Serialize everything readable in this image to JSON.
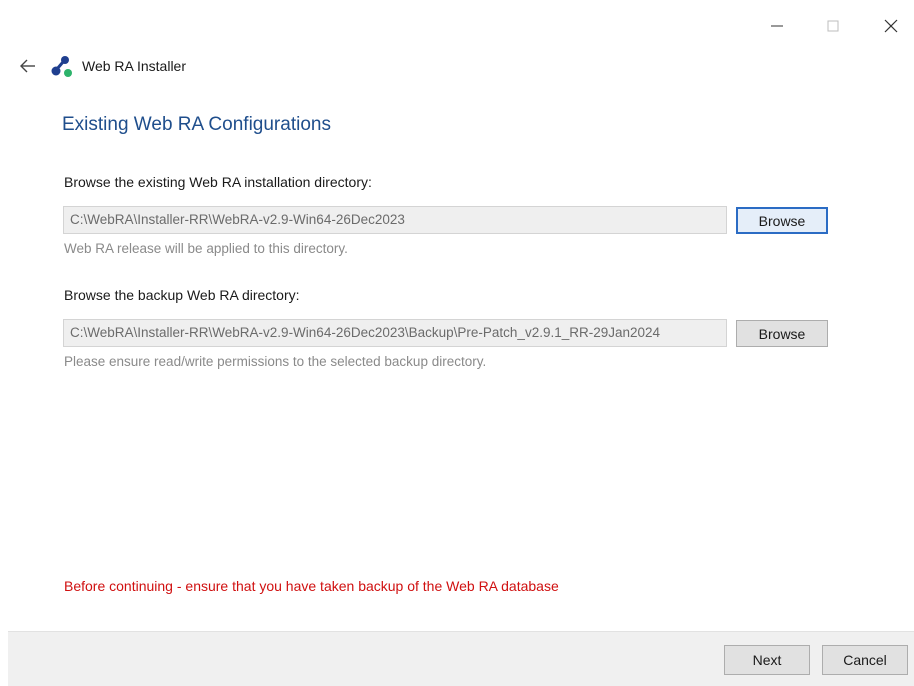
{
  "window": {
    "title": "Web RA Installer",
    "icons": {
      "back": "arrow-left-icon",
      "minimize": "minimize-icon",
      "maximize": "maximize-icon",
      "close": "close-icon",
      "logo": "app-logo-icon"
    }
  },
  "page": {
    "heading": "Existing Web RA Configurations"
  },
  "install_dir": {
    "label": "Browse the existing Web RA installation directory:",
    "value": "C:\\WebRA\\Installer-RR\\WebRA-v2.9-Win64-26Dec2023",
    "browse_label": "Browse",
    "helper": "Web RA release will be applied to this directory."
  },
  "backup_dir": {
    "label": "Browse the backup Web RA directory:",
    "value": "C:\\WebRA\\Installer-RR\\WebRA-v2.9-Win64-26Dec2023\\Backup\\Pre-Patch_v2.9.1_RR-29Jan2024",
    "browse_label": "Browse",
    "helper": "Please ensure read/write permissions to the selected backup directory."
  },
  "warning": "Before continuing - ensure that you have taken backup of the Web RA database",
  "footer": {
    "next_label": "Next",
    "cancel_label": "Cancel"
  },
  "colors": {
    "heading": "#1f4e8c",
    "warning": "#d01010",
    "focus_border": "#2b6cc4",
    "logo_dark": "#1f3f8f",
    "logo_green": "#2db36b"
  }
}
